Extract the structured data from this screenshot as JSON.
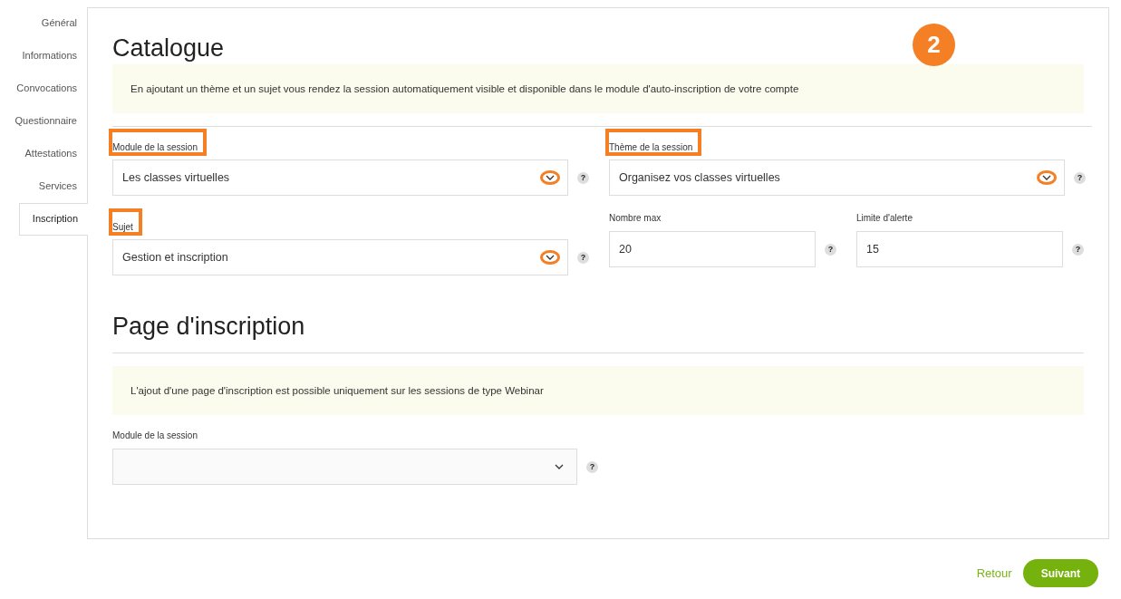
{
  "sidebar": {
    "items": [
      {
        "label": "Général",
        "selected": false
      },
      {
        "label": "Informations",
        "selected": false
      },
      {
        "label": "Convocations",
        "selected": false
      },
      {
        "label": "Questionnaire",
        "selected": false
      },
      {
        "label": "Attestations",
        "selected": false
      },
      {
        "label": "Services",
        "selected": false
      },
      {
        "label": "Inscription",
        "selected": true
      }
    ]
  },
  "step_badge": "2",
  "catalogue": {
    "title": "Catalogue",
    "notice": "En ajoutant un thème et un sujet vous rendez la session automatiquement visible et disponible dans le module d'auto-inscription de votre compte",
    "rows": [
      [
        {
          "kind": "select",
          "label": "Module de la session",
          "value": "Les classes virtuelles",
          "highlighted": true,
          "help": "?"
        },
        {
          "kind": "select",
          "label": "Thème de la session",
          "value": "Organisez vos classes virtuelles",
          "highlighted": true,
          "help": "?"
        }
      ],
      [
        {
          "kind": "select",
          "label": "Sujet",
          "value": "Gestion et inscription",
          "highlighted": true,
          "help": "?"
        },
        {
          "kind": "input",
          "label": "Nombre max",
          "value": "20",
          "highlighted": false,
          "help": "?"
        },
        {
          "kind": "input",
          "label": "Limite d'alerte",
          "value": "15",
          "highlighted": false,
          "help": "?"
        }
      ]
    ]
  },
  "registration_page": {
    "title": "Page d'inscription",
    "notice": "L'ajout d'une page d'inscription est possible uniquement sur les sessions de type Webinar",
    "fields": [
      {
        "kind": "select",
        "label": "Module de la session",
        "highlighted": false,
        "help": "?"
      }
    ]
  },
  "footer": {
    "back": "Retour",
    "next": "Suivant"
  }
}
